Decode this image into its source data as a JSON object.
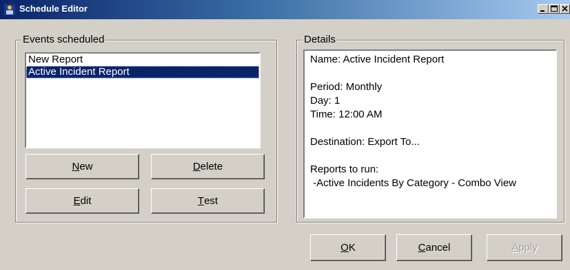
{
  "window": {
    "title": "Schedule Editor"
  },
  "events_group": {
    "label": "Events scheduled",
    "items": [
      {
        "label": "New Report",
        "selected": false
      },
      {
        "label": "Active Incident Report",
        "selected": true
      }
    ]
  },
  "buttons": {
    "new_mnemonic": "N",
    "new_rest": "ew",
    "delete_mnemonic": "D",
    "delete_rest": "elete",
    "edit_mnemonic": "E",
    "edit_rest": "dit",
    "test_mnemonic": "T",
    "test_rest": "est",
    "ok_mnemonic": "O",
    "ok_rest": "K",
    "cancel_mnemonic": "C",
    "cancel_rest": "ancel",
    "apply_mnemonic": "A",
    "apply_rest": "pply"
  },
  "details_group": {
    "label": "Details",
    "name_line": "Name: Active Incident Report",
    "period_line": "Period: Monthly",
    "day_line": "Day: 1",
    "time_line": "Time: 12:00 AM",
    "destination_line": "Destination: Export To...",
    "reports_header": "Reports to run:",
    "report_item": " -Active Incidents By Category - Combo View"
  },
  "colors": {
    "selection": "#0a246a",
    "face": "#d4d0c8"
  },
  "icons": {
    "app": "app-icon",
    "minimize": "minimize-icon",
    "maximize": "maximize-icon",
    "close": "close-icon"
  },
  "state": {
    "apply_enabled": false
  }
}
